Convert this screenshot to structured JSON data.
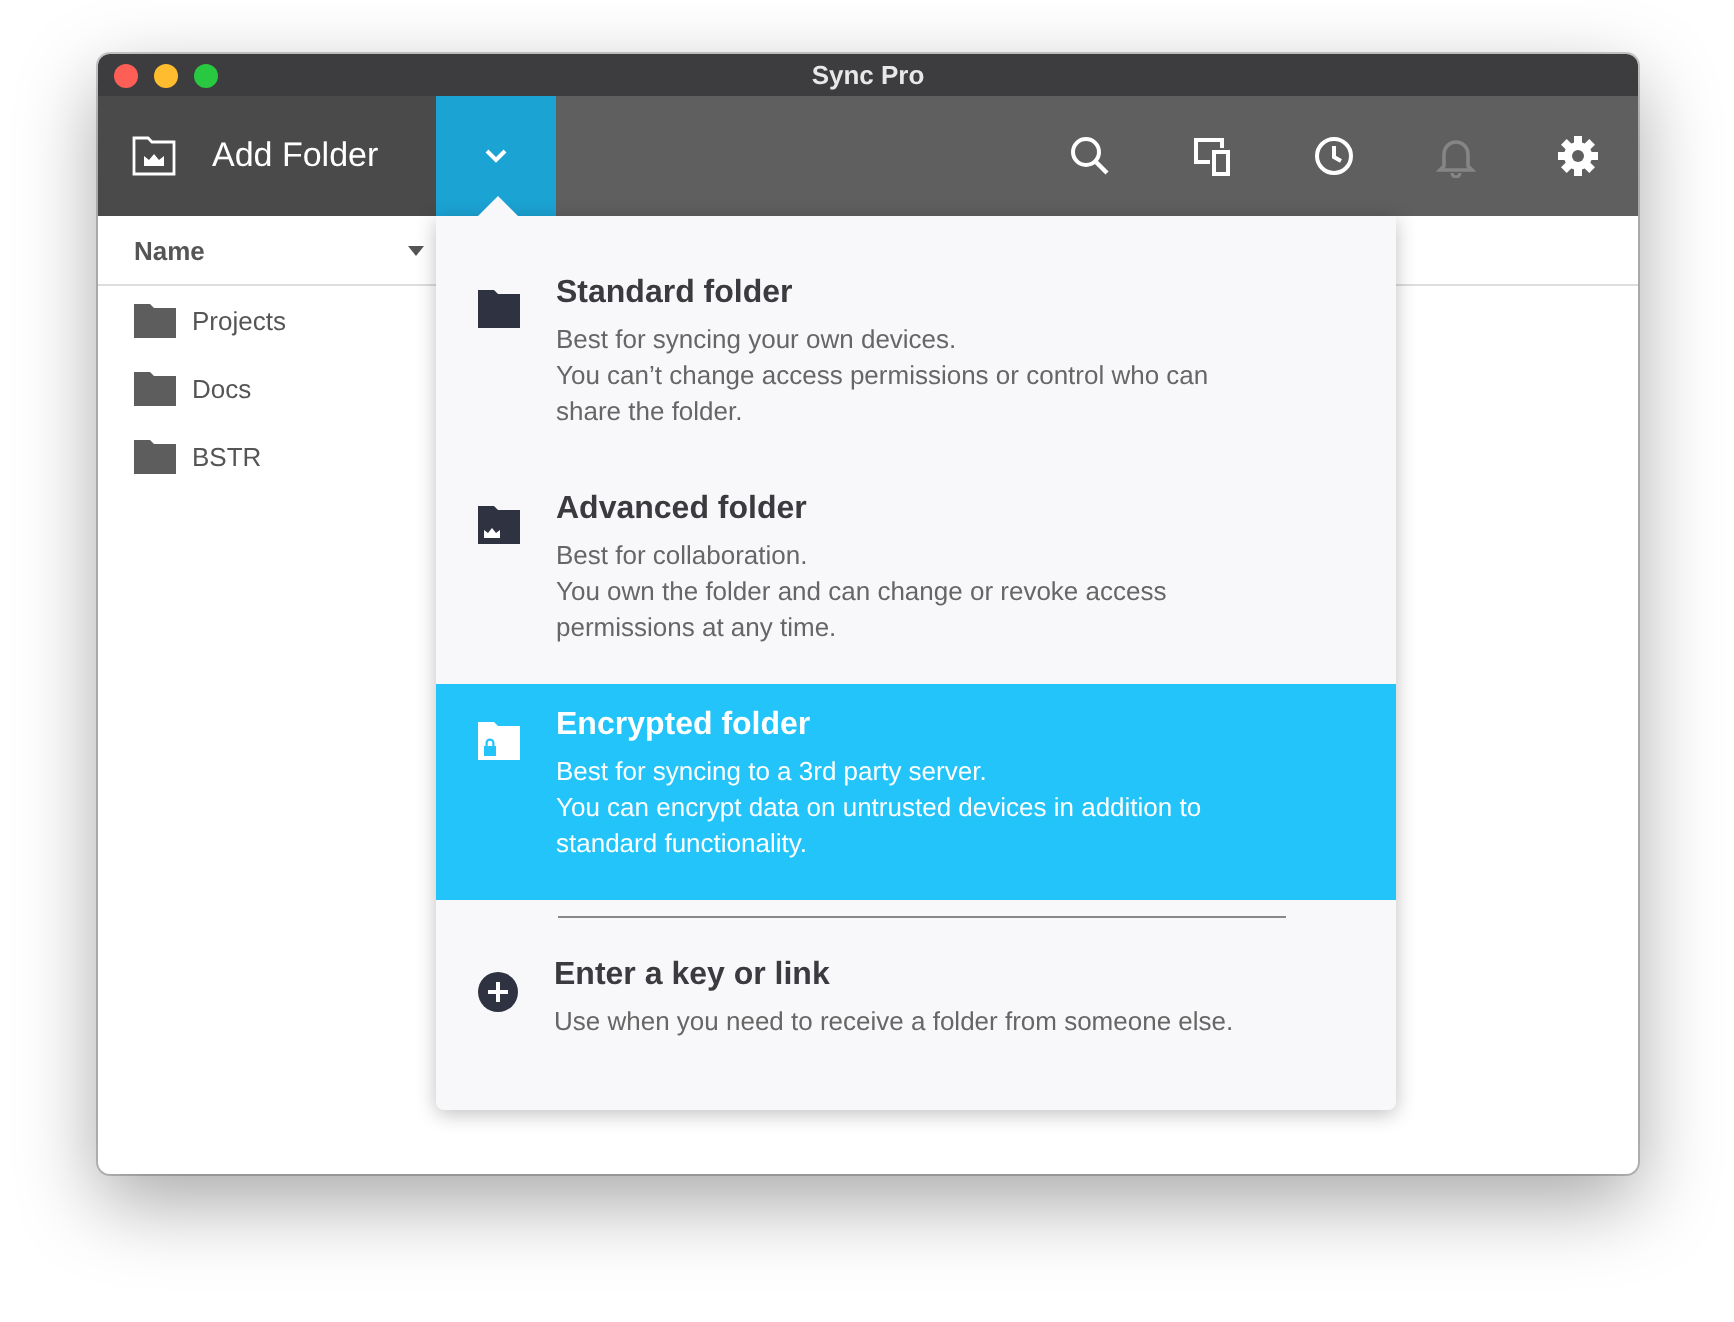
{
  "window": {
    "title": "Sync Pro"
  },
  "toolbar": {
    "add_button": "Add Folder",
    "dropdown_open": true,
    "icons": [
      {
        "kind": "search",
        "disabled": false
      },
      {
        "kind": "devices",
        "disabled": false
      },
      {
        "kind": "history",
        "disabled": false
      },
      {
        "kind": "notifications",
        "disabled": true
      },
      {
        "kind": "settings",
        "disabled": false
      }
    ]
  },
  "table": {
    "columns": [
      "Name"
    ],
    "rows": [
      {
        "name": "Projects"
      },
      {
        "name": "Docs"
      },
      {
        "name": "BSTR"
      }
    ]
  },
  "menu": {
    "items": [
      {
        "kind": "standard",
        "title": "Standard folder",
        "lines": [
          "Best for syncing your own devices.",
          "You can’t change access permissions or control who can share the folder."
        ],
        "selected": false
      },
      {
        "kind": "advanced",
        "title": "Advanced folder",
        "lines": [
          "Best for collaboration.",
          "You own the folder and can change or revoke access permissions at any time."
        ],
        "selected": false
      },
      {
        "kind": "encrypted",
        "title": "Encrypted folder",
        "lines": [
          "Best for syncing to a 3rd party server.",
          "You can encrypt data on untrusted devices in addition to standard functionality."
        ],
        "selected": true
      },
      {
        "kind": "key",
        "title": "Enter a key or link",
        "lines": [
          "Use when you need to receive a folder from someone else."
        ],
        "selected": false
      }
    ]
  }
}
